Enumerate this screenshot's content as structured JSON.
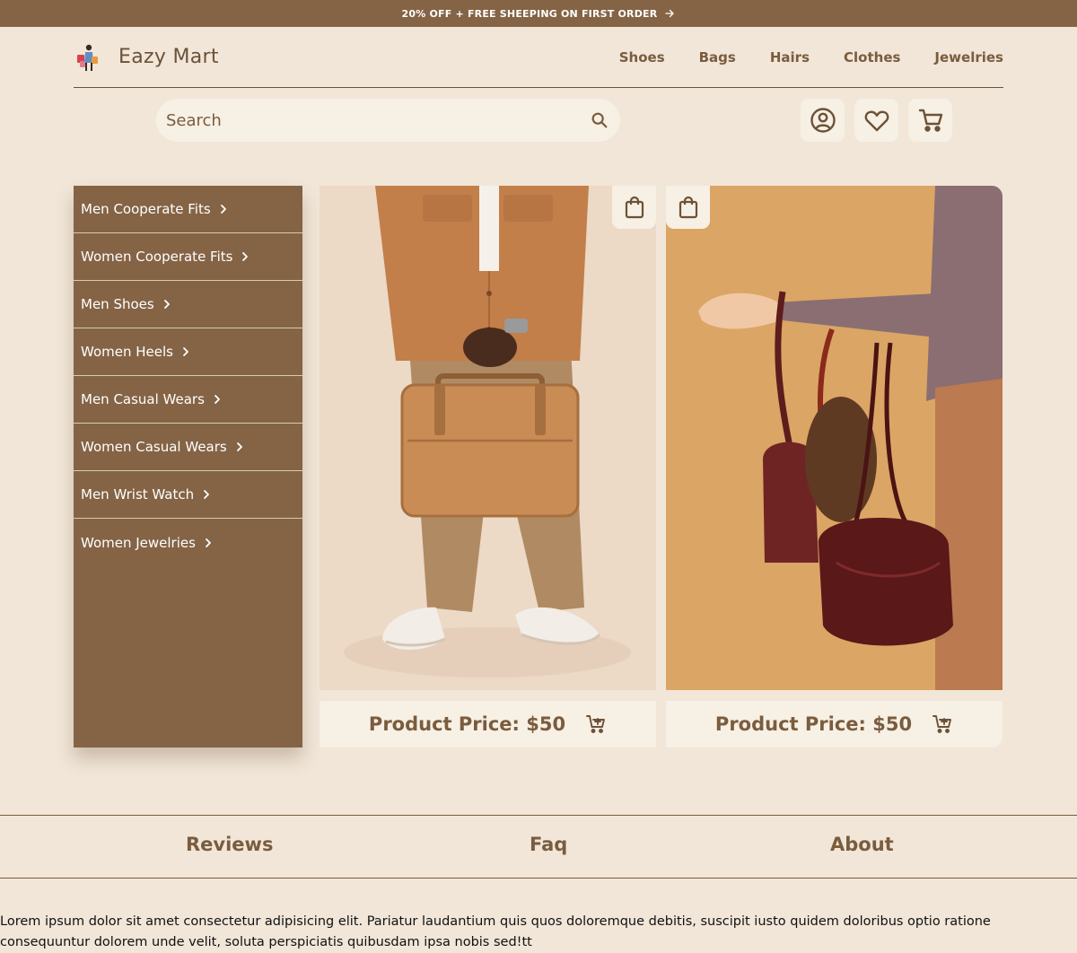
{
  "promo": {
    "text": "20% OFF + FREE SHEEPING ON FIRST ORDER"
  },
  "brand": {
    "name": "Eazy Mart"
  },
  "nav": {
    "items": [
      "Shoes",
      "Bags",
      "Hairs",
      "Clothes",
      "Jewelries"
    ]
  },
  "search": {
    "placeholder": "Search"
  },
  "categories": [
    "Men Cooperate Fits",
    "Women Cooperate Fits",
    "Men Shoes",
    "Women Heels",
    "Men Casual Wears",
    "Women Casual Wears",
    "Men Wrist Watch",
    "Women Jewelries"
  ],
  "products": [
    {
      "price_label": "Product Price: $50"
    },
    {
      "price_label": "Product Price: $50"
    }
  ],
  "footer": {
    "tabs": [
      "Reviews",
      "Faq",
      "About"
    ],
    "text": "Lorem ipsum dolor sit amet consectetur adipisicing elit. Pariatur laudantium quis quos doloremque debitis, suscipit iusto quidem doloribus optio ratione consequuntur dolorem unde velit, soluta perspiciatis quibusdam ipsa nobis sed!tt"
  },
  "colors": {
    "brown": "#846445",
    "background": "#f1e6d8",
    "cream": "#f7f0e4",
    "text_brown": "#7a5c3e"
  },
  "icons": [
    "arrow-right-icon",
    "search-icon",
    "account-circle-icon",
    "heart-icon",
    "cart-icon",
    "chevron-right-icon",
    "shopping-bag-icon",
    "add-to-cart-icon"
  ]
}
